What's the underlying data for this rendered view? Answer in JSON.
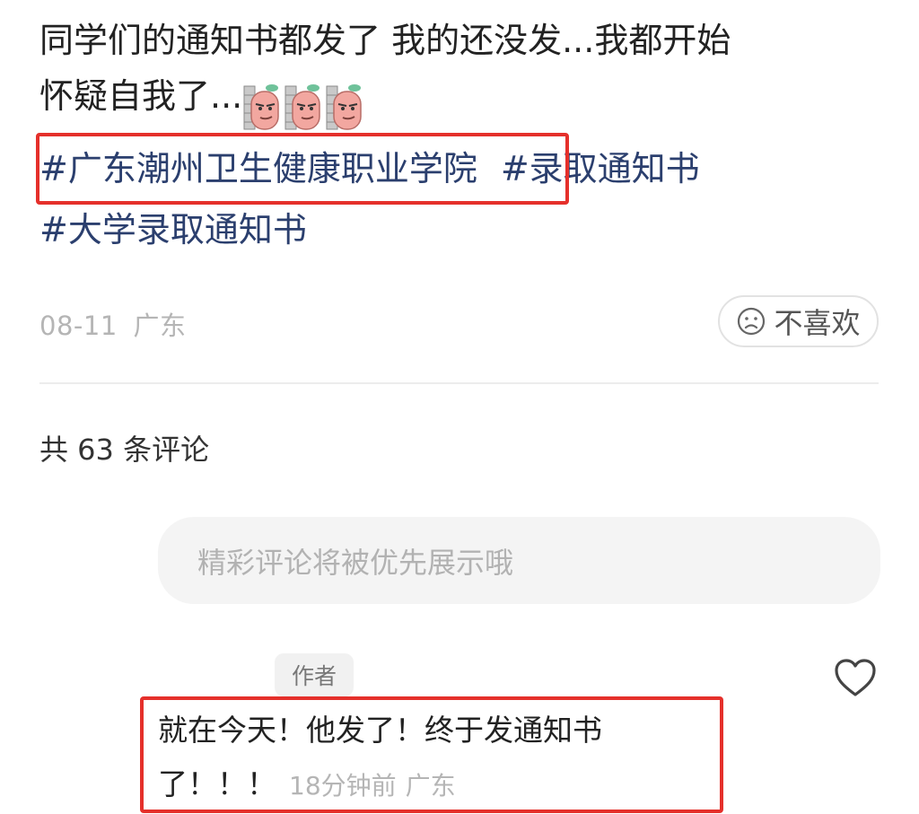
{
  "post": {
    "text_line1": "同学们的通知书都发了 我的还没发...我都开始",
    "text_line2": "怀疑自我了...",
    "emoji_name": "smirking-sausage-emoji",
    "emoji_count": 3,
    "tags": [
      "#广东潮州卫生健康职业学院",
      "#录取通知书",
      "#大学录取通知书"
    ],
    "date": "08-11",
    "location": "广东",
    "dislike_label": "不喜欢",
    "dislike_icon": "frown-face-icon"
  },
  "comments": {
    "count_label": "共 63 条评论",
    "input_placeholder": "精彩评论将被优先展示哦",
    "items": [
      {
        "badge": "作者",
        "text": "就在今天！他发了！终于发通知书了！！！",
        "time": "18分钟前",
        "location": "广东",
        "like_icon": "heart-outline-icon"
      }
    ]
  },
  "colors": {
    "tag": "#2b3f6e",
    "highlight_box": "#e5302b",
    "muted": "#b5b5b5"
  }
}
